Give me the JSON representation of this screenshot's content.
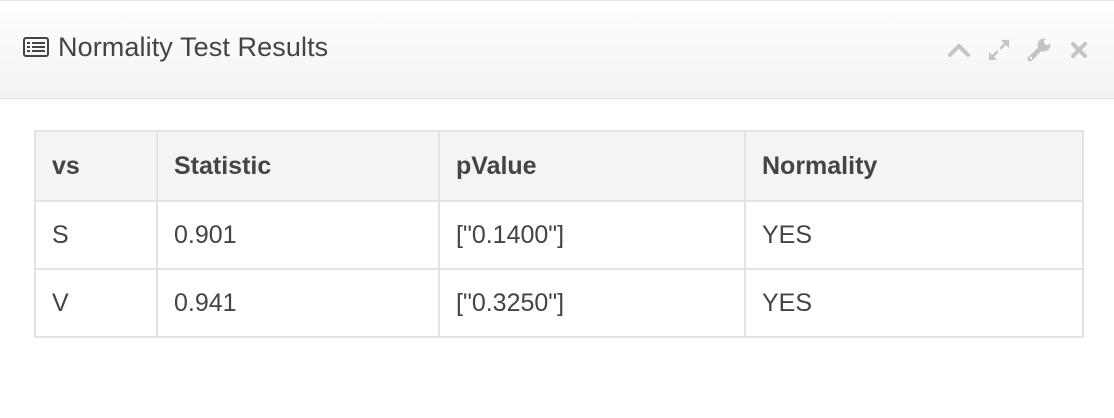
{
  "panel": {
    "title": "Normality Test Results",
    "icon": "list-icon",
    "toolbar": [
      {
        "name": "collapse",
        "icon": "chevron-up-icon"
      },
      {
        "name": "fullscreen",
        "icon": "expand-icon"
      },
      {
        "name": "settings",
        "icon": "wrench-icon"
      },
      {
        "name": "close",
        "icon": "close-icon"
      }
    ]
  },
  "table": {
    "headers": [
      "vs",
      "Statistic",
      "pValue",
      "Normality"
    ],
    "rows": [
      [
        "S",
        "0.901",
        "[\"0.1400\"]",
        "YES"
      ],
      [
        "V",
        "0.941",
        "[\"0.3250\"]",
        "YES"
      ]
    ]
  },
  "colors": {
    "icon_gray": "#c4c4c4",
    "title_text": "#444444",
    "border": "#e3e3e3",
    "header_bg": "#f4f4f4"
  }
}
